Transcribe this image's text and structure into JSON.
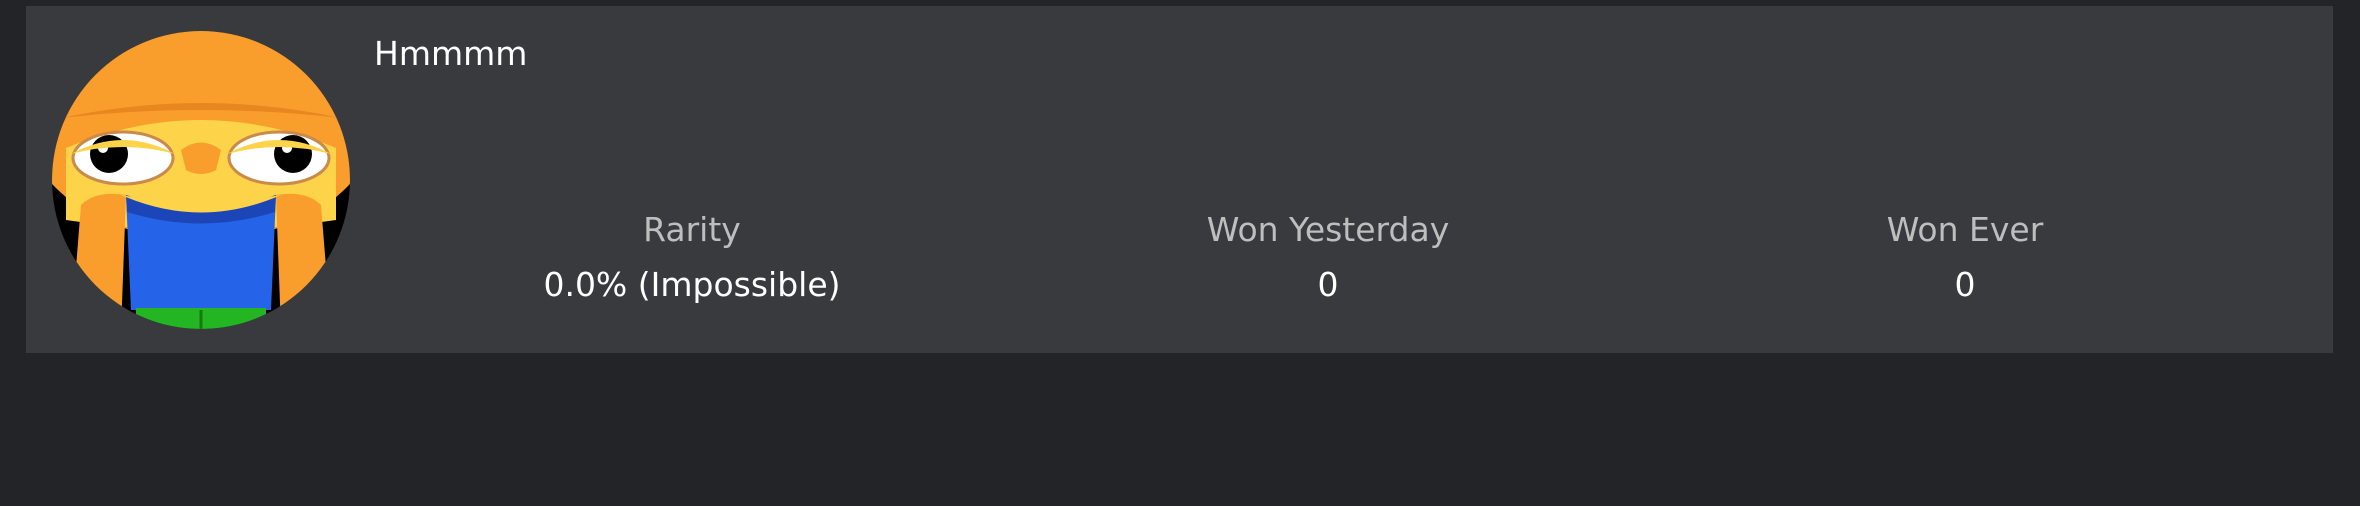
{
  "badge": {
    "title": "Hmmmm",
    "icon": "orange-character-icon"
  },
  "stats": [
    {
      "label": "Rarity",
      "value": "0.0% (Impossible)"
    },
    {
      "label": "Won Yesterday",
      "value": "0"
    },
    {
      "label": "Won Ever",
      "value": "0"
    }
  ],
  "colors": {
    "page_background": "#232427",
    "card_background": "#393a3d",
    "label_text": "#bdbebe",
    "value_text": "#ffffff"
  }
}
